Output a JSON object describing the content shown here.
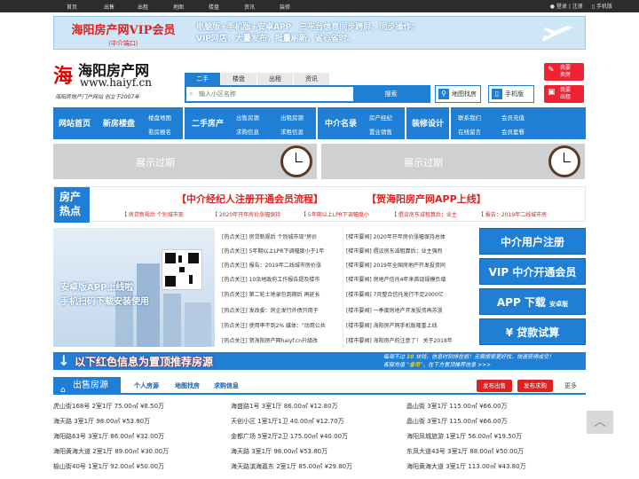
{
  "topbar": {
    "nav": [
      "首页",
      "出售",
      "出租",
      "地图",
      "楼盘",
      "资讯",
      "装修"
    ],
    "login": "登录",
    "divider": "|",
    "register": "注册",
    "mobile": "手机版"
  },
  "banner": {
    "vip_title": "海阳房产网VIP会员",
    "vip_sub": "（中介端口）",
    "line1": "电脑版+手机版+安卓APP　三平台信息同步跨屏、同步操作；",
    "line2": "VIP网店，大量发布，批量刷新，省心省时。"
  },
  "logo": {
    "mark": "海",
    "name": "海阳房产网",
    "url": "www.haiyf.cn",
    "motto": "海阳房地产门户网站 创立于2007年"
  },
  "search": {
    "tabs": [
      "二手",
      "楼盘",
      "出租",
      "资讯"
    ],
    "placeholder": "输入小区名称",
    "button": "搜索"
  },
  "tools": {
    "map": "地图找房",
    "mobile": "手机版"
  },
  "post": [
    {
      "l1": "我要",
      "l2": "卖房"
    },
    {
      "l1": "我要",
      "l2": "出租"
    }
  ],
  "mainnav": {
    "home": "网站首页",
    "newhouse": "新房楼盘",
    "sub1a": "楼盘地图",
    "sub1b": "看房报名",
    "second": "二手房产",
    "sub2a": "出售房源",
    "sub2b": "求购信息",
    "sub3a": "出租房源",
    "sub3b": "求租信息",
    "agent": "中介名录",
    "sub4a": "房产经纪",
    "sub4b": "置业销售",
    "deco": "装修设计",
    "sub5a": "联系我们",
    "sub5b": "在线留言",
    "sub6a": "会员充值",
    "sub6b": "会员套餐"
  },
  "expired": [
    "展示过期",
    "展示过期"
  ],
  "hot": {
    "b1": "房产",
    "b2": "热点",
    "h1": "【中介经纪人注册开通会员流程】",
    "h2": "【贺海阳房产网APP上线】",
    "tags": [
      "【 房贷新规后 个别城市现",
      "【 2020年开年房价涨幅保持",
      "【 5年期以上LPR下调幅度小",
      "【 倡议房东减租算后；业主",
      "【 报告：2019年二线城市房"
    ]
  },
  "appad": {
    "l1": "安卓版APP上线啦",
    "l2": "手机扫码下载安装使用"
  },
  "news": [
    {
      "a": "[热点关注] 房贷新规后 个别城市现\"房价",
      "b": "[楼市要闻] 2020年开年房价涨幅保持总体"
    },
    {
      "a": "[热点关注] 5年期以上LPR下调幅度小于1年",
      "b": "[楼市要闻] 倡议房东减租算后；业主强烈"
    },
    {
      "a": "[热点关注] 报告：2019年二线城市房价涨",
      "b": "[楼市要闻] 2019年全国房地产开发投资同"
    },
    {
      "a": "[热点关注] 10余地政府工作报告提及楼市",
      "b": "[楼市要闻] 房地产信托4年来首现规模负增"
    },
    {
      "a": "[热点关注] 第二轮土地录包到期后 再延长",
      "b": "[楼市要闻] 7月整合信托发行不足2000亿"
    },
    {
      "a": "[热点关注] 发改委：房企发行外债只用于",
      "b": "[楼市要闻] 一季度房地产开发投资再苏浙"
    },
    {
      "a": "[热点关注] 使用率不到2% 媒体：\"动用公共",
      "b": "[楼市要闻] 海阳房产网手机版隆重上线"
    },
    {
      "a": "[热点关注] 贺海阳房产网haiyf.cn升级改",
      "b": "[楼市要闻] 海阳房产的注意了！ 关于2018年"
    }
  ],
  "sidebtns": [
    {
      "label": "中介用户注册"
    },
    {
      "label": "VIP 中介开通会员"
    },
    {
      "label": "APP 下载",
      "small": "安卓版"
    },
    {
      "label": "¥ 贷款试算"
    }
  ],
  "redbar": {
    "arrow": "↓",
    "title": "以下红色信息为置顶推荐房源",
    "ann1a": "每周不过",
    "ann1b": "10",
    "ann1c": "块钱，信息时刻排在前！无需搜索更好找，快速获得成交！",
    "ann2a": "客服充值",
    "ann2b": "\"金币\"",
    "ann2c": "，在下方置顶推荐信息 >>>"
  },
  "sale": {
    "tab": "出售房源",
    "sub": [
      "个人房源",
      "地图找房",
      "求购信息"
    ],
    "btn_sell": "发布出售",
    "btn_buy": "发布求购",
    "more": "更多"
  },
  "listings": [
    [
      "虎山街168号 2室1厅 75.00㎡ ¥8.50万",
      "海盛路1号 3室1厅 86.00㎡ ¥12.80万",
      "晶山街 3室1厅 115.00㎡ ¥66.00万"
    ],
    [
      "海天路 3室1厅 98.00㎡ ¥53.80万",
      "天创小区 1室1厅1卫 40.00㎡ ¥12.70万",
      "晶山街 3室1厅 115.00㎡ ¥66.00万"
    ],
    [
      "海阳路63号 3室1厅 86.00㎡ ¥32.00万",
      "金都广场 5室2厅2卫 175.00㎡ ¥40.00万",
      "海阳凤城旅游 1室1厅 56.00㎡ ¥19.50万"
    ],
    [
      "海阳黄海大道 2室1厅 89.00㎡ ¥30.00万",
      "海天路 3室1厅 98.00㎡ ¥53.80万",
      "东凤大道43号 3室1厅 88.00㎡ ¥50.00万"
    ],
    [
      "榆山街40号 1室1厅 92.00㎡ ¥50.00万",
      "海天路滨海嘉东 2室1厅 85.00㎡ ¥29.80万",
      "海阳黄海大道 3室1厅 113.00㎡ ¥43.80万"
    ]
  ],
  "totop": "︿"
}
